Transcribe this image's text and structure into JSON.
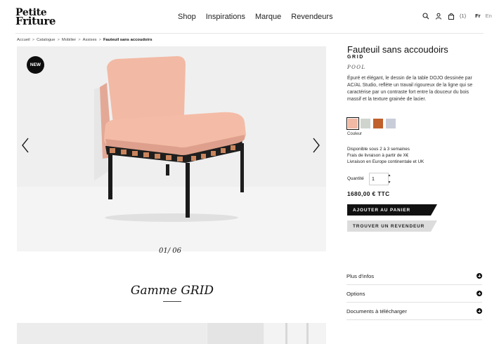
{
  "brand": {
    "logo_line1": "Petite",
    "logo_line2": "Friture"
  },
  "nav": [
    "Shop",
    "Inspirations",
    "Marque",
    "Revendeurs"
  ],
  "header": {
    "icons": [
      "search-icon",
      "user-icon",
      "bag-icon"
    ],
    "cart_count": "(1)",
    "lang_active": "Fr",
    "lang_other": "En"
  },
  "breadcrumb": [
    "Accueil",
    "Catalogue",
    "Mobilier",
    "Assises",
    "Fauteuil sans accoudoirs"
  ],
  "gallery": {
    "badge": "NEW",
    "current": "01",
    "separator": "/",
    "total": "06"
  },
  "product": {
    "title": "Fauteuil sans accoudoirs",
    "collection": "GRID",
    "designer": "POOL",
    "description": "Épuré et élégant, le dessin de la table DOJO dessinée par AC/AL Studio, reflète un travail rigoureux de la ligne qui se caractérise par un contraste fort entre la douceur du bois massif et la texture grainée de lacier.",
    "swatch_label": "Couleur",
    "swatches": [
      "#f2b9a4",
      "#cfd4cf",
      "#c0602c",
      "#c9cdd9"
    ],
    "shipping": [
      "Disponible sous 2 à 3 semaines",
      "Frais de livraison à partir de X€",
      "Livraison en Europe continentale et UK"
    ],
    "quantity_label": "Quantité",
    "quantity_value": "1",
    "price": "1680,00 € TTC",
    "add_to_cart": "AJOUTER AU PANIER",
    "find_dealer": "TROUVER UN REVENDEUR"
  },
  "accordion": [
    "Plus d'infos",
    "Options",
    "Documents à télécharger"
  ],
  "range": {
    "title": "Gamme GRID"
  }
}
